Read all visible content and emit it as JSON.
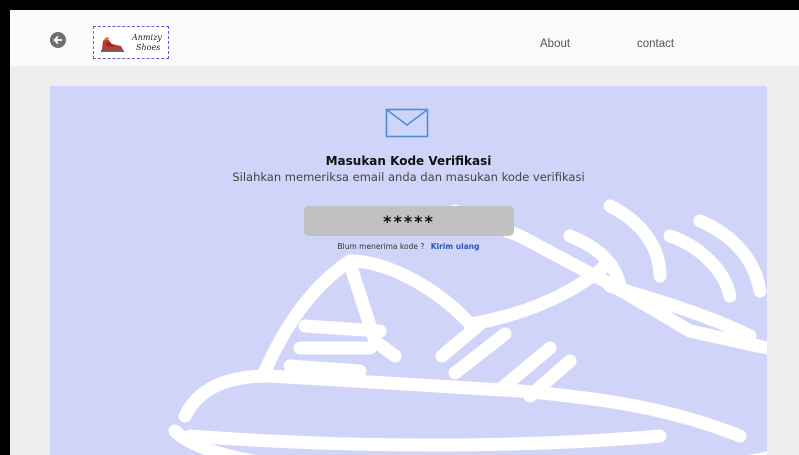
{
  "navbar": {
    "back_icon": "arrow-left-icon",
    "logo_line1": "Anmizy",
    "logo_line2": "Shoes",
    "about_label": "About",
    "contact_label": "contact"
  },
  "verification": {
    "icon": "envelope-icon",
    "title": "Masukan Kode Verifikasi",
    "subtitle": "Silahkan memeriksa email anda dan masukan kode verifikasi",
    "code_value": "*****",
    "resend_prompt": "Blum menerima kode ?",
    "resend_link": "Kirim ulang",
    "background_icon": "sneaker-icon"
  },
  "colors": {
    "page_bg": "#eeeeee",
    "navbar_bg": "#fafafa",
    "card_bg": "#d0d4f8",
    "mail_icon": "#4a8fd8",
    "input_bg": "#c1c1c1",
    "link": "#2a57b8"
  }
}
